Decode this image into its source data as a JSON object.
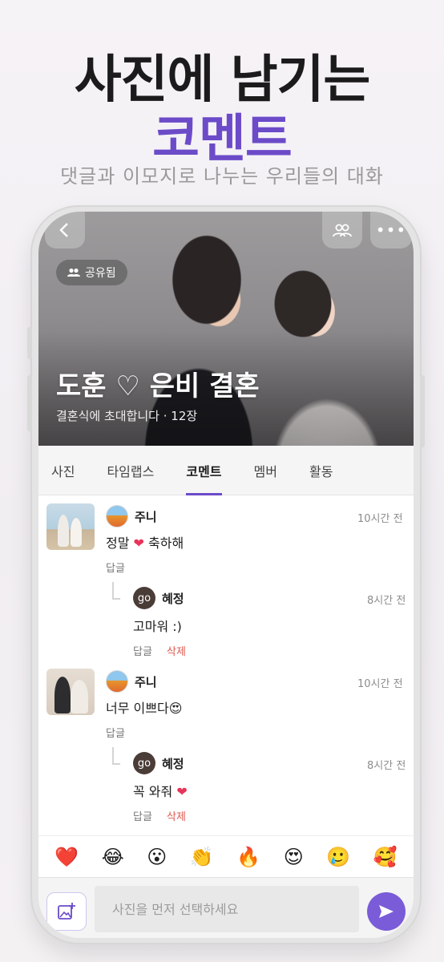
{
  "promo": {
    "title": "사진에 남기는",
    "accent": "코멘트",
    "subtitle": "댓글과 이모지로 나누는 우리들의 대화"
  },
  "header": {
    "back_icon": "chevron-left-icon",
    "members_icon": "people-icon",
    "more_icon": "more-icon",
    "shared_badge": "공유됨",
    "title": "도훈 ♡ 은비 결혼",
    "subtitle": "결혼식에 초대합니다 · 12장"
  },
  "tabs": [
    "사진",
    "타임랩스",
    "코멘트",
    "멤버",
    "활동"
  ],
  "active_tab": "코멘트",
  "comments": [
    {
      "author": "주니",
      "time": "10시간 전",
      "text_before": "정말",
      "emoji": "❤",
      "text_after": "축하해",
      "reply_label": "답글",
      "reply": {
        "avatar": "go",
        "author": "혜정",
        "time": "8시간 전",
        "text": "고마워 :)",
        "reply_label": "답글",
        "delete_label": "삭제"
      }
    },
    {
      "author": "주니",
      "time": "10시간 전",
      "text_before": "너무 이쁘다",
      "emoji": "😍",
      "text_after": "",
      "reply_label": "답글",
      "reply": {
        "avatar": "go",
        "author": "혜정",
        "time": "8시간 전",
        "text": "꼭 와줘",
        "emoji": "❤",
        "reply_label": "답글",
        "delete_label": "삭제"
      }
    }
  ],
  "emoji_bar": [
    "❤️",
    "😂",
    "😮",
    "👏",
    "🔥",
    "😍",
    "🥲",
    "🥰"
  ],
  "composer": {
    "placeholder": "사진을 먼저 선택하세요",
    "add_photo_icon": "add-photo-icon",
    "send_icon": "send-icon"
  },
  "colors": {
    "accent": "#6c4bc9",
    "send": "#7a5bd8",
    "delete": "#e0584f",
    "heart": "#e8345a"
  }
}
